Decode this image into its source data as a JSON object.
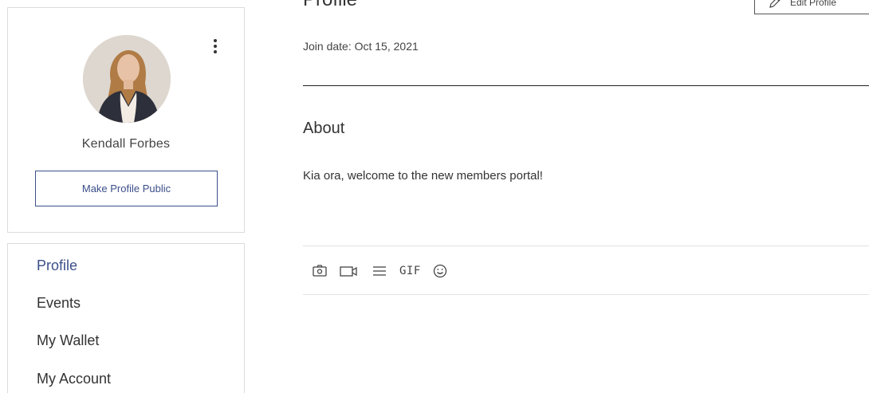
{
  "profile_card": {
    "member_name": "Kendall Forbes",
    "make_public_label": "Make Profile Public",
    "more_actions_icon": "vertical-ellipsis-icon"
  },
  "nav": {
    "items": [
      {
        "label": "Profile",
        "active": true
      },
      {
        "label": "Events",
        "active": false
      },
      {
        "label": "My Wallet",
        "active": false
      },
      {
        "label": "My Account",
        "active": false
      }
    ]
  },
  "main": {
    "page_title": "Profile",
    "edit_label": "Edit Profile",
    "join_date": "Join date: Oct 15, 2021",
    "about_heading": "About",
    "about_text": "Kia ora, welcome to the new members portal!"
  },
  "composer": {
    "tools": [
      "camera-icon",
      "video-icon",
      "divider-icon",
      "gif-icon",
      "emoji-icon"
    ],
    "gif_label": "GIF"
  },
  "colors": {
    "accent": "#3b4f8a",
    "border": "#dcdcdc",
    "text": "#333333"
  }
}
